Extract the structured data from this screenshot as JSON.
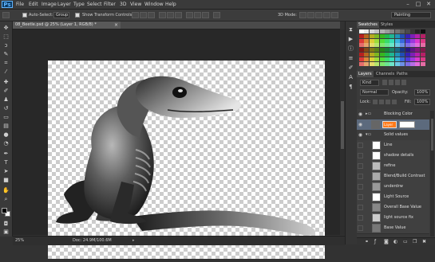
{
  "app": {
    "logo": "Ps",
    "name": "Adobe Photoshop"
  },
  "menu": [
    "File",
    "Edit",
    "Image",
    "Layer",
    "Type",
    "Select",
    "Filter",
    "3D",
    "View",
    "Window",
    "Help"
  ],
  "window_controls": {
    "minimize": "–",
    "maximize": "□",
    "close": "✕"
  },
  "options_bar": {
    "auto_select_label": "Auto-Select:",
    "auto_select_value": "Group",
    "show_transform_label": "Show Transform Controls",
    "mode_3d_label": "3D Mode:",
    "workspace_value": "Painting"
  },
  "document": {
    "tab_title": "08_Beetle.psd @ 25% (Layer 1, RGB/8) *",
    "tab_close": "×"
  },
  "status_bar": {
    "zoom": "25%",
    "doc_size": "Doc: 24.9M/100.6M"
  },
  "panels": {
    "swatches_tabs": [
      "Swatches",
      "Styles"
    ],
    "layers_tabs": [
      "Layers",
      "Channels",
      "Paths"
    ],
    "kind_filter": "Kind",
    "blend_mode": "Normal",
    "opacity_label": "Opacity:",
    "opacity_value": "100%",
    "lock_label": "Lock:",
    "fill_label": "Fill:",
    "fill_value": "100%"
  },
  "layers": [
    {
      "name": "Blocking Color",
      "type": "group",
      "visible": true
    },
    {
      "name": "Layer",
      "type": "masked-selected",
      "visible": true
    },
    {
      "name": "Solid values",
      "type": "group",
      "visible": true
    },
    {
      "name": "Line",
      "type": "layer",
      "visible": false
    },
    {
      "name": "shadow details",
      "type": "layer",
      "visible": false
    },
    {
      "name": "refine",
      "type": "layer",
      "visible": false
    },
    {
      "name": "Blend/Build Contrast",
      "type": "layer",
      "visible": false
    },
    {
      "name": "underdrw",
      "type": "layer",
      "visible": false
    },
    {
      "name": "Light Source",
      "type": "layer",
      "visible": false
    },
    {
      "name": "Overall Base Value",
      "type": "layer",
      "visible": false
    },
    {
      "name": "light source fix",
      "type": "layer",
      "visible": false
    },
    {
      "name": "Base Value",
      "type": "layer",
      "visible": false
    }
  ],
  "layer_buttons": [
    "link-icon",
    "fx-icon",
    "mask-icon",
    "adjustment-icon",
    "folder-icon",
    "new-layer-icon",
    "trash-icon"
  ],
  "tools": [
    "move-tool-icon",
    "marquee-tool-icon",
    "lasso-tool-icon",
    "quick-select-tool-icon",
    "crop-tool-icon",
    "eyedropper-tool-icon",
    "healing-tool-icon",
    "brush-tool-icon",
    "clone-stamp-tool-icon",
    "history-brush-tool-icon",
    "eraser-tool-icon",
    "gradient-tool-icon",
    "blur-tool-icon",
    "dodge-tool-icon",
    "pen-tool-icon",
    "type-tool-icon",
    "path-select-tool-icon",
    "shape-tool-icon",
    "hand-tool-icon",
    "zoom-tool-icon"
  ],
  "colors": {
    "foreground": "#000000",
    "background": "#ffffff",
    "selected_layer": "#5c6a7d",
    "mask_accent": "#ff7a1a"
  }
}
